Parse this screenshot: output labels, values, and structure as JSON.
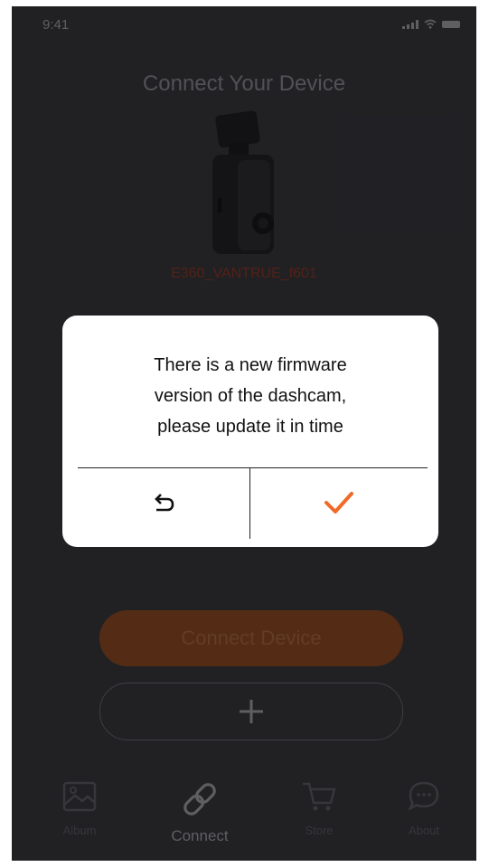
{
  "status_bar": {
    "time": "9:41"
  },
  "header": {
    "title": "Connect Your Device"
  },
  "device": {
    "name": "E360_VANTRUE_f601"
  },
  "dialog": {
    "message_lines": [
      "There is a new firmware",
      "version of the dashcam,",
      "please update it in time"
    ],
    "back_icon": "undo-arrow-icon",
    "confirm_icon": "checkmark-icon"
  },
  "actions": {
    "connect_label": "Connect Device",
    "add_icon": "plus-icon"
  },
  "tabs": [
    {
      "label": "Album",
      "icon": "image-icon",
      "active": false
    },
    {
      "label": "Connect",
      "icon": "link-icon",
      "active": true
    },
    {
      "label": "Store",
      "icon": "cart-icon",
      "active": false
    },
    {
      "label": "About",
      "icon": "chat-icon",
      "active": false
    }
  ],
  "colors": {
    "accent": "#f06a28",
    "background": "#2b2b2f"
  }
}
